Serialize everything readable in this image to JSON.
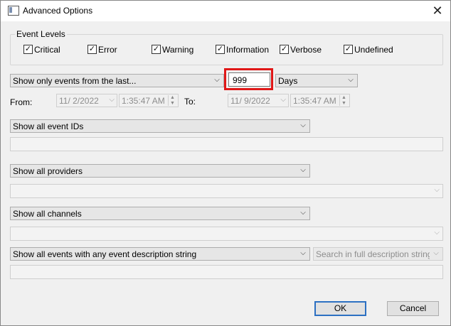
{
  "window": {
    "title": "Advanced Options"
  },
  "event_levels": {
    "legend": "Event Levels",
    "items": [
      {
        "label": "Critical",
        "checked": true
      },
      {
        "label": "Error",
        "checked": true
      },
      {
        "label": "Warning",
        "checked": true
      },
      {
        "label": "Information",
        "checked": true
      },
      {
        "label": "Verbose",
        "checked": true
      },
      {
        "label": "Undefined",
        "checked": true
      }
    ]
  },
  "time_filter": {
    "mode": "Show only events from the last...",
    "amount": "999",
    "unit": "Days",
    "from_label": "From:",
    "from_date": "11/  2/2022",
    "from_time": "1:35:47 AM",
    "to_label": "To:",
    "to_date": "11/  9/2022",
    "to_time": "1:35:47 AM"
  },
  "filters": {
    "event_ids": "Show all event IDs",
    "providers": "Show all providers",
    "channels": "Show all channels",
    "description": "Show all events with any event description string",
    "search_scope": "Search in full description string (S"
  },
  "buttons": {
    "ok": "OK",
    "cancel": "Cancel"
  },
  "icons": {
    "checkbox_check": "✓",
    "dropdown": "⌵",
    "close": "✕"
  }
}
